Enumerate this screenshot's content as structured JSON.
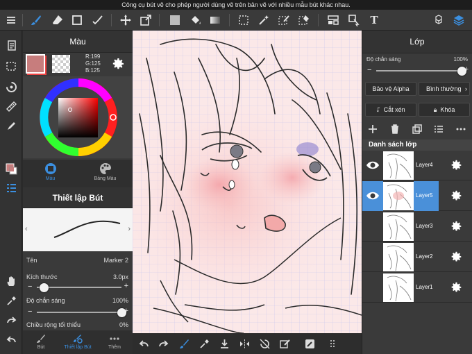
{
  "notice": "Công cụ bút vẽ cho phép người dùng vẽ trên bản vẽ với nhiều mẫu bút khác nhau.",
  "colors": {
    "accent": "#3b8fe0",
    "current_color": "#c77d7d",
    "selected_layer": "#4a90d9"
  },
  "color_panel": {
    "title": "Màu",
    "rgb": {
      "r": "R:199",
      "g": "G:125",
      "b": "B:125"
    },
    "tabs": [
      {
        "label": "Màu",
        "icon": "circle-dot-icon"
      },
      {
        "label": "Bảng Màu",
        "icon": "palette-icon"
      }
    ]
  },
  "pen_panel": {
    "title": "Thiết lập Bút",
    "name_label": "Tên",
    "name_value": "Marker 2",
    "size_label": "Kích thước",
    "size_value": "3.0px",
    "size_level": 0.08,
    "opacity_label": "Độ chắn sáng",
    "opacity_value": "100%",
    "opacity_level": 1.0,
    "min_width_label": "Chiều rộng tối thiểu",
    "min_width_value": "0%"
  },
  "bottom_tabs": [
    {
      "label": "Bút",
      "icon": "brush-icon"
    },
    {
      "label": "Thiết lập Bút",
      "icon": "pen-settings-icon"
    },
    {
      "label": "Thêm",
      "icon": "more-icon"
    }
  ],
  "layer_panel": {
    "title": "Lớp",
    "opacity_label": "Độ chắn sáng",
    "opacity_value": "100%",
    "opacity_level": 1.0,
    "alpha_button": "Bảo vệ Alpha",
    "blend_button": "Bình thường",
    "clip_button": "Cắt xén",
    "lock_button": "Khóa",
    "list_title": "Danh sách lớp",
    "layers": [
      {
        "name": "Layer4",
        "visible": true,
        "selected": false
      },
      {
        "name": "Layer5",
        "visible": true,
        "selected": true
      },
      {
        "name": "Layer3",
        "visible": false,
        "selected": false
      },
      {
        "name": "Layer2",
        "visible": false,
        "selected": false
      },
      {
        "name": "Layer1",
        "visible": false,
        "selected": false
      }
    ]
  }
}
